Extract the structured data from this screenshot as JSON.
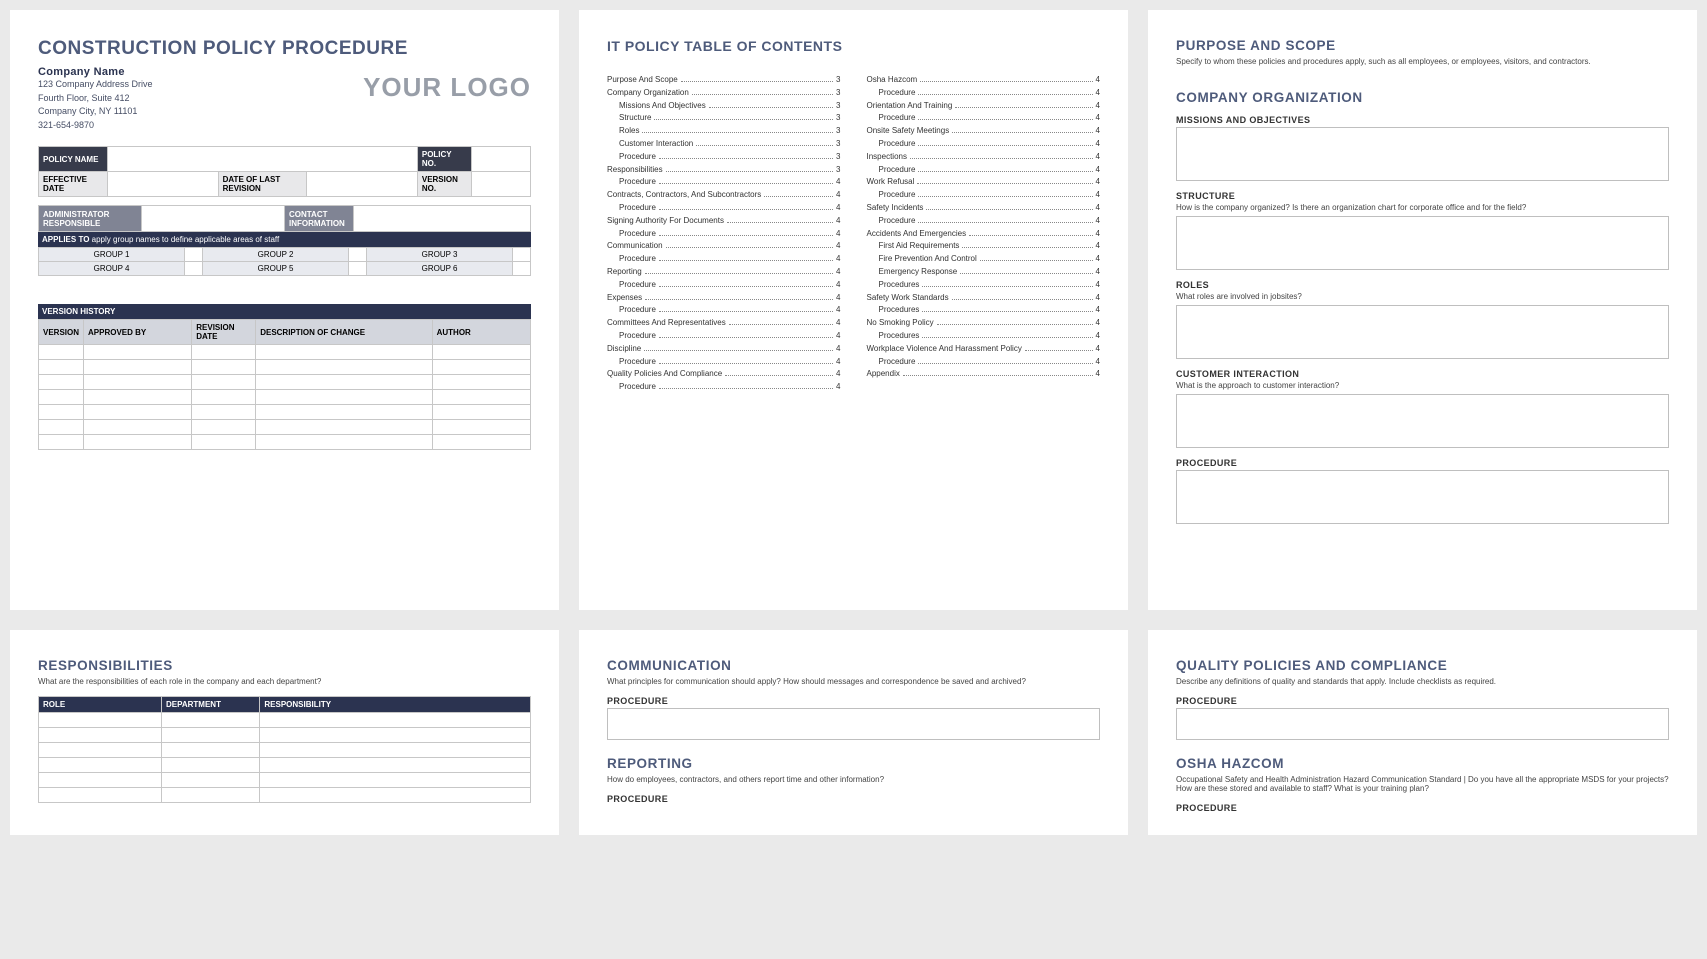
{
  "p1": {
    "title": "CONSTRUCTION POLICY PROCEDURE",
    "company_name": "Company Name",
    "addr1": "123 Company Address Drive",
    "addr2": "Fourth Floor, Suite 412",
    "addr3": "Company City, NY  11101",
    "phone": "321-654-9870",
    "logo": "YOUR LOGO",
    "labels": {
      "policy_name": "POLICY NAME",
      "policy_no": "POLICY NO.",
      "effective_date": "EFFECTIVE DATE",
      "last_rev": "DATE OF LAST REVISION",
      "version_no": "VERSION NO.",
      "admin": "ADMINISTRATOR RESPONSIBLE",
      "contact": "CONTACT INFORMATION",
      "applies_to": "APPLIES TO",
      "applies_desc": "apply group names to define applicable areas of staff"
    },
    "groups": [
      "GROUP 1",
      "GROUP 2",
      "GROUP 3",
      "GROUP 4",
      "GROUP 5",
      "GROUP 6"
    ],
    "vh_title": "VERSION HISTORY",
    "vh_headers": [
      "VERSION",
      "APPROVED BY",
      "REVISION DATE",
      "DESCRIPTION OF CHANGE",
      "AUTHOR"
    ]
  },
  "toc": {
    "title": "IT POLICY TABLE OF CONTENTS",
    "left": [
      {
        "t": "Purpose And Scope",
        "p": "3"
      },
      {
        "t": "Company Organization",
        "p": "3"
      },
      {
        "t": "Missions And Objectives",
        "p": "3",
        "i": 1
      },
      {
        "t": "Structure",
        "p": "3",
        "i": 1
      },
      {
        "t": "Roles",
        "p": "3",
        "i": 1
      },
      {
        "t": "Customer Interaction",
        "p": "3",
        "i": 1
      },
      {
        "t": "Procedure",
        "p": "3",
        "i": 1
      },
      {
        "t": "Responsibilities",
        "p": "3"
      },
      {
        "t": "Procedure",
        "p": "4",
        "i": 1
      },
      {
        "t": "Contracts, Contractors, And Subcontractors",
        "p": "4"
      },
      {
        "t": "Procedure",
        "p": "4",
        "i": 1
      },
      {
        "t": "Signing Authority For Documents",
        "p": "4"
      },
      {
        "t": "Procedure",
        "p": "4",
        "i": 1
      },
      {
        "t": "Communication",
        "p": "4"
      },
      {
        "t": "Procedure",
        "p": "4",
        "i": 1
      },
      {
        "t": "Reporting",
        "p": "4"
      },
      {
        "t": "Procedure",
        "p": "4",
        "i": 1
      },
      {
        "t": "Expenses",
        "p": "4"
      },
      {
        "t": "Procedure",
        "p": "4",
        "i": 1
      },
      {
        "t": "Committees And Representatives",
        "p": "4"
      },
      {
        "t": "Procedure",
        "p": "4",
        "i": 1
      },
      {
        "t": "Discipline",
        "p": "4"
      },
      {
        "t": "Procedure",
        "p": "4",
        "i": 1
      },
      {
        "t": "Quality Policies And Compliance",
        "p": "4"
      },
      {
        "t": "Procedure",
        "p": "4",
        "i": 1
      }
    ],
    "right": [
      {
        "t": "Osha Hazcom",
        "p": "4"
      },
      {
        "t": "Procedure",
        "p": "4",
        "i": 1
      },
      {
        "t": "Orientation And Training",
        "p": "4"
      },
      {
        "t": "Procedure",
        "p": "4",
        "i": 1
      },
      {
        "t": "Onsite Safety Meetings",
        "p": "4"
      },
      {
        "t": "Procedure",
        "p": "4",
        "i": 1
      },
      {
        "t": "Inspections",
        "p": "4"
      },
      {
        "t": "Procedure",
        "p": "4",
        "i": 1
      },
      {
        "t": "Work Refusal",
        "p": "4"
      },
      {
        "t": "Procedure",
        "p": "4",
        "i": 1
      },
      {
        "t": "Safety Incidents",
        "p": "4"
      },
      {
        "t": "Procedure",
        "p": "4",
        "i": 1
      },
      {
        "t": "Accidents And Emergencies",
        "p": "4"
      },
      {
        "t": "First Aid Requirements",
        "p": "4",
        "i": 1
      },
      {
        "t": "Fire Prevention And Control",
        "p": "4",
        "i": 1
      },
      {
        "t": "Emergency Response",
        "p": "4",
        "i": 1
      },
      {
        "t": "Procedures",
        "p": "4",
        "i": 1
      },
      {
        "t": "Safety Work Standards",
        "p": "4"
      },
      {
        "t": "Procedures",
        "p": "4",
        "i": 1
      },
      {
        "t": "No Smoking Policy",
        "p": "4"
      },
      {
        "t": "Procedures",
        "p": "4",
        "i": 1
      },
      {
        "t": "Workplace Violence And Harassment Policy",
        "p": "4"
      },
      {
        "t": "Procedure",
        "p": "4",
        "i": 1
      },
      {
        "t": "Appendix",
        "p": "4"
      }
    ]
  },
  "p3": {
    "h1": "PURPOSE AND SCOPE",
    "d1": "Specify to whom these policies and procedures apply, such as all employees, or employees, visitors, and contractors.",
    "h2": "COMPANY ORGANIZATION",
    "s1": "MISSIONS AND OBJECTIVES",
    "s2": "STRUCTURE",
    "s2d": "How is the company organized? Is there an organization chart for corporate office and for the field?",
    "s3": "ROLES",
    "s3d": "What roles are involved in jobsites?",
    "s4": "CUSTOMER INTERACTION",
    "s4d": "What is the approach to customer interaction?",
    "s5": "PROCEDURE"
  },
  "p4": {
    "h": "RESPONSIBILITIES",
    "d": "What are the responsibilities of each role in the company and each department?",
    "headers": [
      "ROLE",
      "DEPARTMENT",
      "RESPONSIBILITY"
    ]
  },
  "p5": {
    "h1": "COMMUNICATION",
    "d1": "What principles for communication should apply?  How should messages and correspondence be saved and archived?",
    "proc": "PROCEDURE",
    "h2": "REPORTING",
    "d2": "How do employees, contractors, and others report time and other information?"
  },
  "p6": {
    "h1": "QUALITY POLICIES AND COMPLIANCE",
    "d1": "Describe any definitions of quality and standards that apply.  Include checklists as required.",
    "proc": "PROCEDURE",
    "h2": "OSHA HAZCOM",
    "d2": "Occupational Safety and Health Administration Hazard Communication Standard |  Do you have all the appropriate MSDS for your projects?  How are these stored and available to staff?  What is your training plan?"
  }
}
